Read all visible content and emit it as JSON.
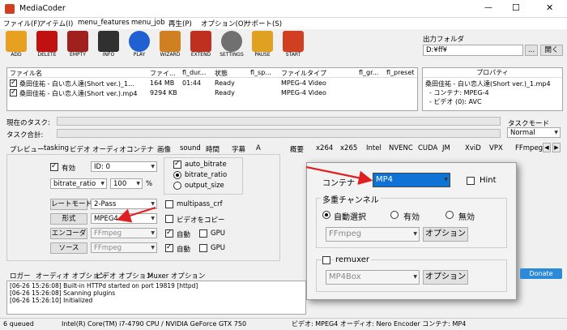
{
  "app": {
    "title": "MediaCoder",
    "min": "—",
    "max": "☐",
    "close": "✕"
  },
  "menu": [
    "ファイル(F)",
    "アイテム(I)",
    "menu_features",
    "menu_job",
    "再生(P)",
    "オプション(O)",
    "サポート(S)"
  ],
  "toolbar": [
    {
      "label": "ADD",
      "icon": "add-icon",
      "color": "#e8a020"
    },
    {
      "label": "DELETE",
      "icon": "delete-icon",
      "color": "#c01010"
    },
    {
      "label": "EMPTY",
      "icon": "empty-icon",
      "color": "#a02020"
    },
    {
      "label": "INFO",
      "icon": "info-icon",
      "color": "#303030"
    },
    {
      "label": "PLAY",
      "icon": "play-icon",
      "color": "#2060d0"
    },
    {
      "label": "WIZARD",
      "icon": "wizard-icon",
      "color": "#d08020"
    },
    {
      "label": "EXTEND",
      "icon": "extend-icon",
      "color": "#c03020"
    },
    {
      "label": "SETTINGS",
      "icon": "settings-icon",
      "color": "#707070"
    },
    {
      "label": "PAUSE",
      "icon": "pause-icon",
      "color": "#e0a020"
    },
    {
      "label": "START",
      "icon": "start-icon",
      "color": "#d04020"
    }
  ],
  "output": {
    "label": "出力フォルダ",
    "path": "D:¥ff¥",
    "browse": "...",
    "open": "開く"
  },
  "files": {
    "headers": [
      "ファイル名",
      "ファイ...",
      "fl_dur...",
      "状態",
      "fl_sp...",
      "ファイルタイプ",
      "fl_gr...",
      "fl_preset"
    ],
    "rows": [
      [
        "桑田佳祐 - 白い恋人達(Short ver.)_1...",
        "164 MB",
        "01:44",
        "Ready",
        "",
        "MPEG-4 Video",
        "",
        ""
      ],
      [
        "桑田佳祐 - 白い恋人達(Short ver.).mp4",
        "9294 KB",
        "",
        "Ready",
        "",
        "MPEG-4 Video",
        "",
        ""
      ]
    ]
  },
  "props": {
    "header": "プロパティ",
    "title": "桑田佳祐 - 白い恋人達(Short ver.)_1.mp4",
    "line1": "- コンテナ: MPEG-4",
    "line2": "- ビデオ (0): AVC"
  },
  "task": {
    "current": "現在のタスク:",
    "total": "タスク合計:",
    "mode_label": "タスクモード",
    "mode_value": "Normal"
  },
  "left_tabs": [
    "プレビュー",
    "tasking",
    "ビデオ",
    "オーディオ",
    "コンテナ",
    "画像",
    "sound",
    "時間",
    "字幕",
    "A"
  ],
  "video": {
    "enabled": "有効",
    "id": "ID: 0",
    "bitrate_ratio": "bitrate_ratio",
    "pct": "100",
    "pct_unit": "%",
    "auto_bitrate": "auto_bitrate",
    "bitrate_ratio_opt": "bitrate_ratio",
    "output_size": "output_size",
    "rate_mode_btn": "レートモード",
    "rate_mode": "2-Pass",
    "multipass": "multipass_crf",
    "format_btn": "形式",
    "format": "MPEG4",
    "copy_video": "ビデオをコピー",
    "encoder_btn": "エンコーダ",
    "encoder": "FFmpeg",
    "source_btn": "ソース",
    "source": "FFmpeg",
    "auto1": "自動",
    "gpu1": "GPU",
    "auto2": "自動",
    "gpu2": "GPU"
  },
  "right_tabs": [
    "概要",
    "x264",
    "x265",
    "Intel",
    "NVENC",
    "CUDA",
    "JM",
    "XviD",
    "VPX",
    "FFmpeg"
  ],
  "popup": {
    "container_label": "コンテナ",
    "container": "MP4",
    "hint": "Hint",
    "mux_title": "多重チャンネル",
    "auto_select": "自動選択",
    "enabled": "有効",
    "disabled": "無効",
    "muxer": "FFmpeg",
    "option1": "オプション",
    "remuxer": "remuxer",
    "remuxer_val": "MP4Box",
    "option2": "オプション"
  },
  "bottom_tabs": [
    "ロガー",
    "オーディオ オプション",
    "ビデオ オプション",
    "Muxer オプション"
  ],
  "log": [
    "[06-26 15:26:08] Built-in HTTPd started on port 19819 [httpd]",
    "[06-26 15:26:08] Scanning plugins",
    "[06-26 15:26:10] Initialized"
  ],
  "donate": "Donate",
  "status": {
    "queued": "6 queued",
    "cpu": "Intel(R) Core(TM) i7-4790 CPU / NVIDIA GeForce GTX 750",
    "info": "ビデオ: MPEG4 オーディオ: Nero Encoder コンテナ: MP4"
  }
}
